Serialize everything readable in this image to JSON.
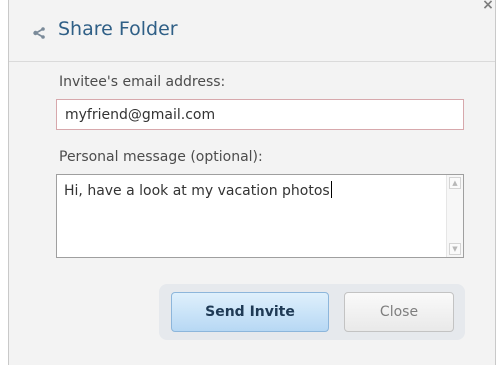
{
  "dialog": {
    "title": "Share Folder",
    "close_glyph": "×"
  },
  "form": {
    "email_label": "Invitee's email address:",
    "email_value": "myfriend@gmail.com",
    "message_label": "Personal message (optional):",
    "message_value": "Hi, have a look at my vacation photos"
  },
  "buttons": {
    "send_label": "Send Invite",
    "close_label": "Close"
  },
  "icons": {
    "title_icon": "share-icon",
    "dialog_close": "close-icon",
    "scroll_up": "scroll-up-arrow-icon",
    "scroll_down": "scroll-down-arrow-icon"
  },
  "colors": {
    "title": "#2f5f86",
    "primary_button": "#b7d8f4",
    "email_border": "#d7a8ac"
  }
}
